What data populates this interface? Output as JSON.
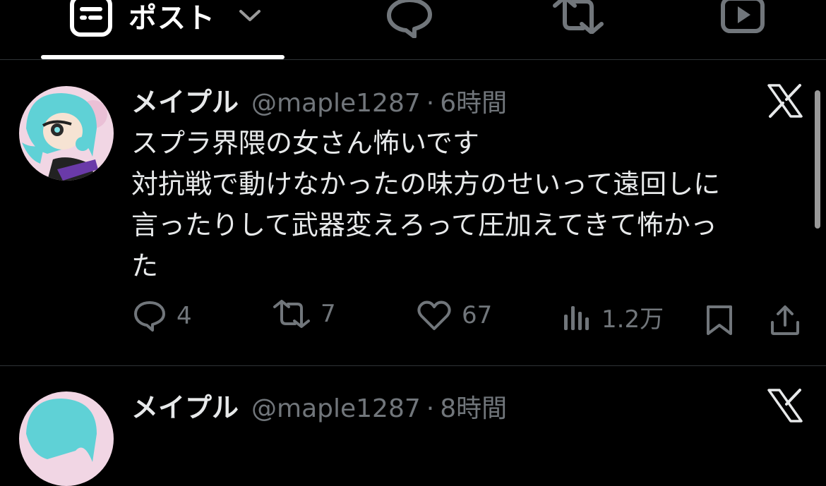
{
  "tabs": {
    "post_label": "ポスト"
  },
  "tweets": [
    {
      "name": "メイプル",
      "handle": "@maple1287",
      "time": "6時間",
      "lines": [
        "スプラ界隈の女さん怖いです",
        "対抗戦で動けなかったの味方のせいって遠回しに",
        "言ったりして武器変えろって圧加えてきて怖かっ",
        "た"
      ],
      "replies": "4",
      "reposts": "7",
      "likes": "67",
      "views": "1.2万"
    },
    {
      "name": "メイプル",
      "handle": "@maple1287",
      "time": "8時間"
    }
  ]
}
